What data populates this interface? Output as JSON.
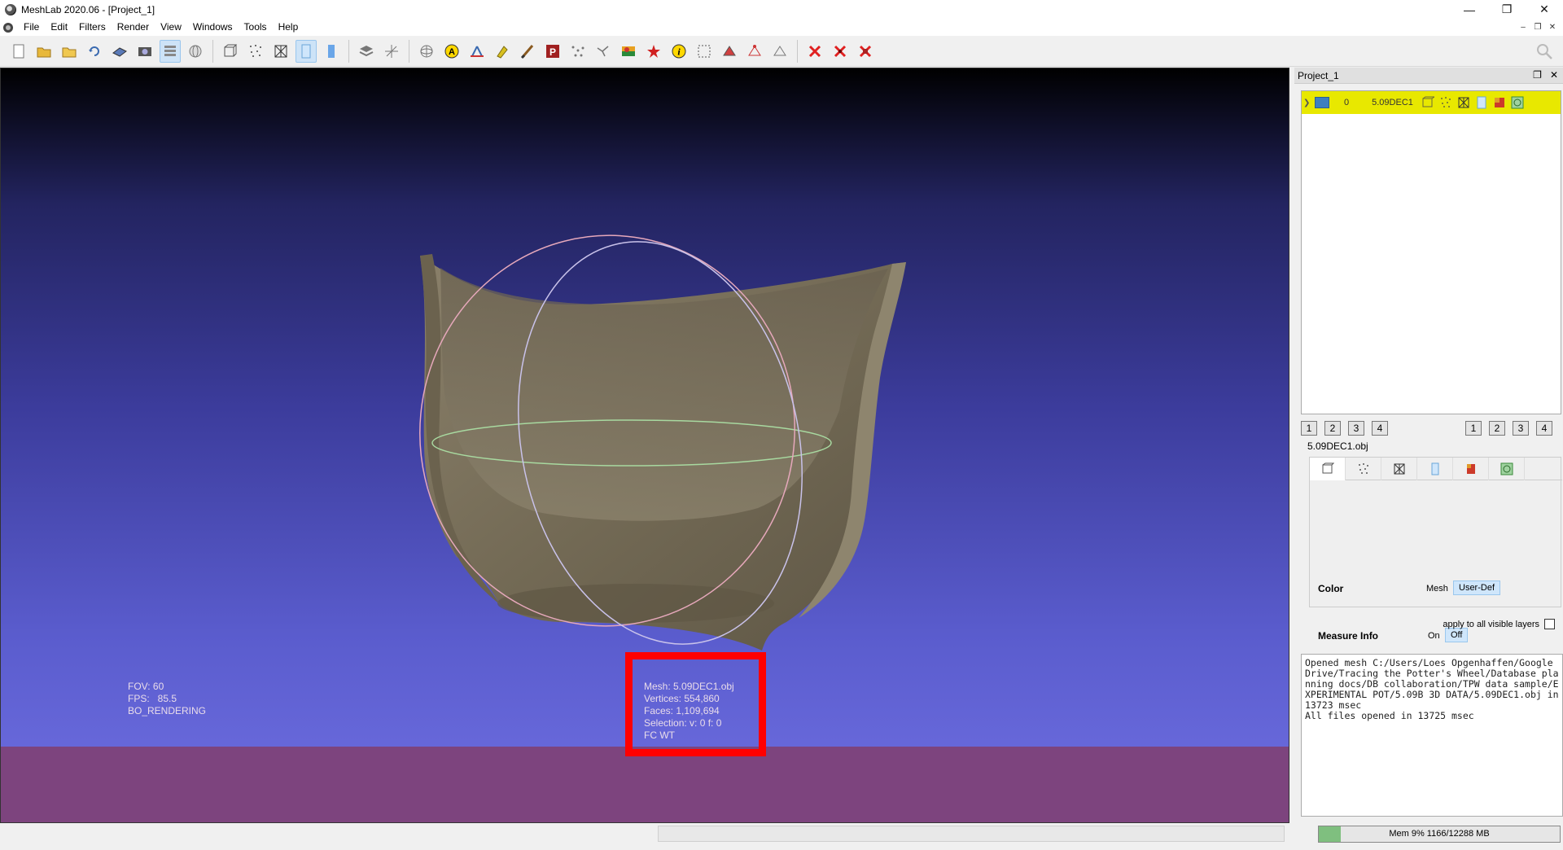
{
  "window": {
    "title": "MeshLab 2020.06 - [Project_1]"
  },
  "menu": [
    "File",
    "Edit",
    "Filters",
    "Render",
    "View",
    "Windows",
    "Tools",
    "Help"
  ],
  "toolbar": {
    "groups": [
      [
        "new-project-icon",
        "open-project-icon",
        "open-mesh-icon",
        "reload-icon",
        "save-icon",
        "snapshot-icon",
        "layers-icon",
        "globe-icon"
      ],
      [
        "box-icon",
        "points-icon",
        "wireframe-icon",
        "flat-shading-icon",
        "smooth-shading-icon"
      ],
      [
        "layer-stack-icon",
        "axes-icon"
      ],
      [
        "trackball-icon",
        "annotation-a-icon",
        "measure-icon",
        "paint-icon",
        "brush-icon",
        "pick-points-icon",
        "align-icon",
        "connect-icon",
        "texture-icon",
        "georef-icon",
        "info-icon",
        "select-icon",
        "select-faces-icon",
        "select-vertices-icon",
        "select-connected-icon"
      ],
      [
        "delete-faces-icon",
        "delete-vertices-icon",
        "delete-selection-icon"
      ]
    ]
  },
  "viewport": {
    "info_left": [
      "FOV: 60",
      "FPS:   85.5",
      "BO_RENDERING"
    ],
    "info_mid": [
      "Mesh: 5.09DEC1.obj",
      "Vertices: 554,860",
      "Faces: 1,109,694",
      "Selection: v: 0 f: 0",
      "FC WT"
    ],
    "colors": {
      "band": "#7d447e",
      "highlight_box": "#ff0000",
      "mesh": "#7a6f58"
    }
  },
  "dock": {
    "title": "Project_1",
    "layer": {
      "id": "0",
      "name": "5.09DEC1"
    },
    "num_left": [
      "1",
      "2",
      "3",
      "4"
    ],
    "num_right": [
      "1",
      "2",
      "3",
      "4"
    ],
    "file_label": "5.09DEC1.obj",
    "render": {
      "color_label": "Color",
      "color_opt": "Mesh",
      "color_sel": "User-Def",
      "measure_label": "Measure Info",
      "measure_on": "On",
      "measure_sel": "Off"
    },
    "apply_label": "apply to all visible layers",
    "log": "Opened mesh C:/Users/Loes Opgenhaffen/Google Drive/Tracing the Potter's Wheel/Database planning docs/DB collaboration/TPW data sample/EXPERIMENTAL POT/5.09B 3D DATA/5.09DEC1.obj in 13723 msec\nAll files opened in 13725 msec"
  },
  "status": {
    "memory": "Mem 9% 1166/12288 MB",
    "memory_fraction": 0.09
  }
}
